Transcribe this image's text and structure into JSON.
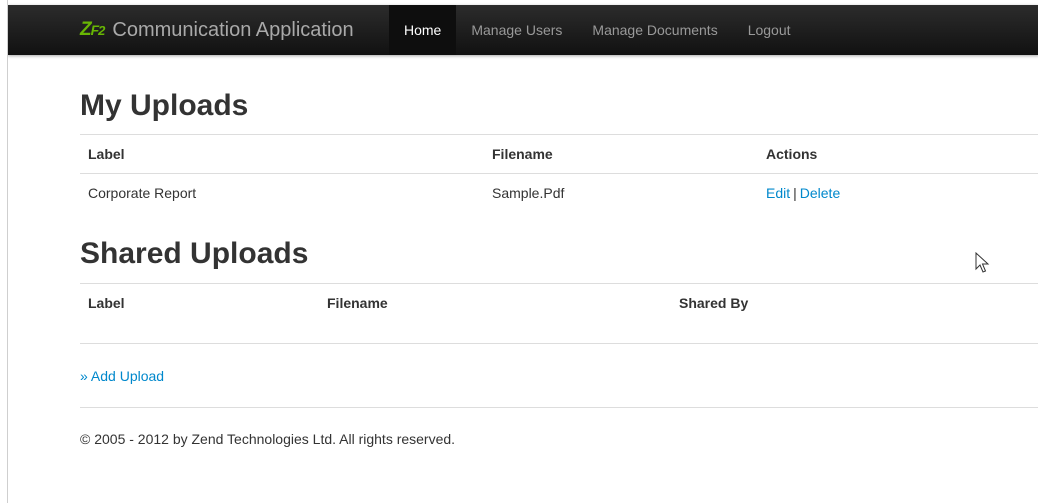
{
  "navbar": {
    "brand_logo": "ZF2",
    "brand_title": "Communication Application",
    "items": [
      {
        "label": "Home",
        "active": true
      },
      {
        "label": "Manage Users",
        "active": false
      },
      {
        "label": "Manage Documents",
        "active": false
      },
      {
        "label": "Logout",
        "active": false
      }
    ]
  },
  "my_uploads": {
    "title": "My Uploads",
    "columns": [
      "Label",
      "Filename",
      "Actions"
    ],
    "rows": [
      {
        "label": "Corporate Report",
        "filename": "Sample.Pdf",
        "edit": "Edit",
        "separator": "|",
        "delete": "Delete"
      }
    ]
  },
  "shared_uploads": {
    "title": "Shared Uploads",
    "columns": [
      "Label",
      "Filename",
      "Shared By"
    ]
  },
  "add_upload": "» Add Upload",
  "footer": "© 2005 - 2012 by Zend Technologies Ltd. All rights reserved.",
  "colors": {
    "link": "#0088cc",
    "navbar": "#1b1b1b",
    "logo": "#68b604"
  },
  "icons": {
    "cursor": "arrow-pointer-icon"
  }
}
